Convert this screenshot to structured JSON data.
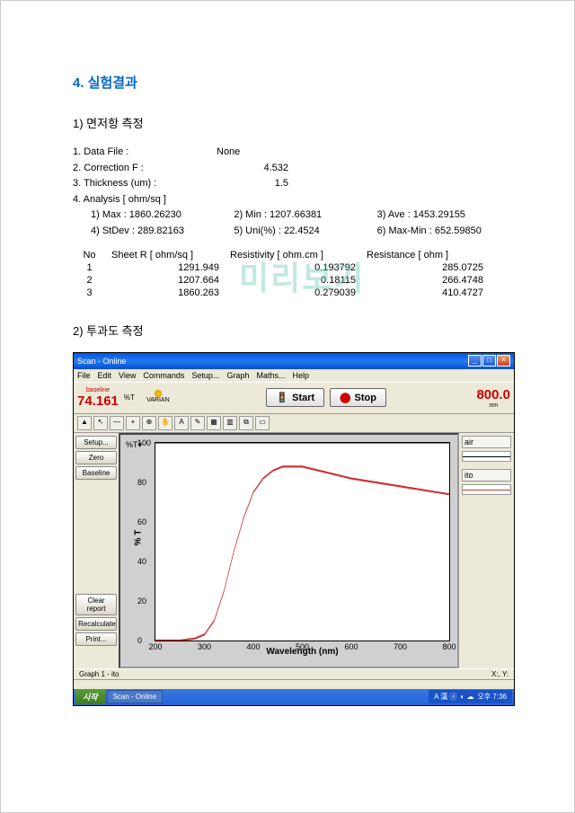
{
  "title": "4. 실험결과",
  "section1": {
    "heading": "1) 면저항 측정",
    "fields": {
      "data_file_label": "1. Data File :",
      "data_file_value": "None",
      "correction_label": "2. Correction F :",
      "correction_value": "4.532",
      "thickness_label": "3. Thickness (um) :",
      "thickness_value": "1.5",
      "analysis_label": "4. Analysis [ ohm/sq ]",
      "max_label": "1) Max : 1860.26230",
      "min_label": "2) Min : 1207.66381",
      "ave_label": "3) Ave : 1453.29155",
      "stdev_label": "4) StDev : 289.82163",
      "uni_label": "5) Uni(%) : 22.4524",
      "maxmin_label": "6) Max-Min : 652.59850"
    },
    "table": {
      "headers": {
        "no": "No",
        "sheet_r": "Sheet R [ ohm/sq ]",
        "resistivity": "Resistivity [ ohm.cm ]",
        "resistance": "Resistance [ ohm ]"
      },
      "rows": [
        {
          "no": "1",
          "sheet_r": "1291.949",
          "resistivity": "0.193792",
          "resistance": "285.0725"
        },
        {
          "no": "2",
          "sheet_r": "1207.664",
          "resistivity": "0.18115",
          "resistance": "266.4748"
        },
        {
          "no": "3",
          "sheet_r": "1860.263",
          "resistivity": "0.279039",
          "resistance": "410.4727"
        }
      ]
    }
  },
  "section2": {
    "heading": "2) 투과도 측정"
  },
  "app": {
    "title": "Scan - Online",
    "menu": [
      "File",
      "Edit",
      "View",
      "Commands",
      "Setup...",
      "Graph",
      "Maths...",
      "Help"
    ],
    "readout_left": {
      "label": "baseline",
      "value": "74.161",
      "unit": "%T",
      "logo": "VARIAN"
    },
    "start_btn": "Start",
    "stop_btn": "Stop",
    "readout_right": {
      "value": "800.0",
      "unit": "nm"
    },
    "sidebar": {
      "setup": "Setup...",
      "zero": "Zero",
      "baseline": "Baseline",
      "clear": "Clear report",
      "recalc": "Recalculate",
      "print": "Print..."
    },
    "legend": {
      "air": "air",
      "ito": "ito"
    },
    "chart": {
      "ylabel": "% T",
      "xlabel": "Wavelength (nm)"
    },
    "graph_footer_left": "Graph 1 - ito",
    "graph_footer_right": "X:, Y:",
    "taskbar": {
      "start": "시작",
      "task": "Scan - Online",
      "tray_lang": "A 漢 ⓐ",
      "tray_time": "오후 7:36"
    }
  },
  "chart_data": {
    "type": "line",
    "title": "",
    "xlabel": "Wavelength (nm)",
    "ylabel": "% T",
    "xlim": [
      200,
      800
    ],
    "ylim": [
      0,
      100
    ],
    "x_ticks": [
      200,
      300,
      400,
      500,
      600,
      700,
      800
    ],
    "y_ticks": [
      0,
      20,
      40,
      60,
      80,
      100
    ],
    "series": [
      {
        "name": "air",
        "color": "#000000",
        "x": [
          200,
          800
        ],
        "values": [
          100,
          100
        ]
      },
      {
        "name": "ito",
        "color": "#cc3333",
        "x": [
          200,
          250,
          280,
          300,
          320,
          340,
          360,
          380,
          400,
          420,
          440,
          460,
          480,
          500,
          550,
          600,
          650,
          700,
          750,
          800
        ],
        "values": [
          0,
          0,
          1,
          3,
          10,
          25,
          45,
          62,
          75,
          82,
          86,
          88,
          88,
          88,
          85,
          82,
          80,
          78,
          76,
          74
        ]
      }
    ]
  },
  "watermark": "미리보기"
}
